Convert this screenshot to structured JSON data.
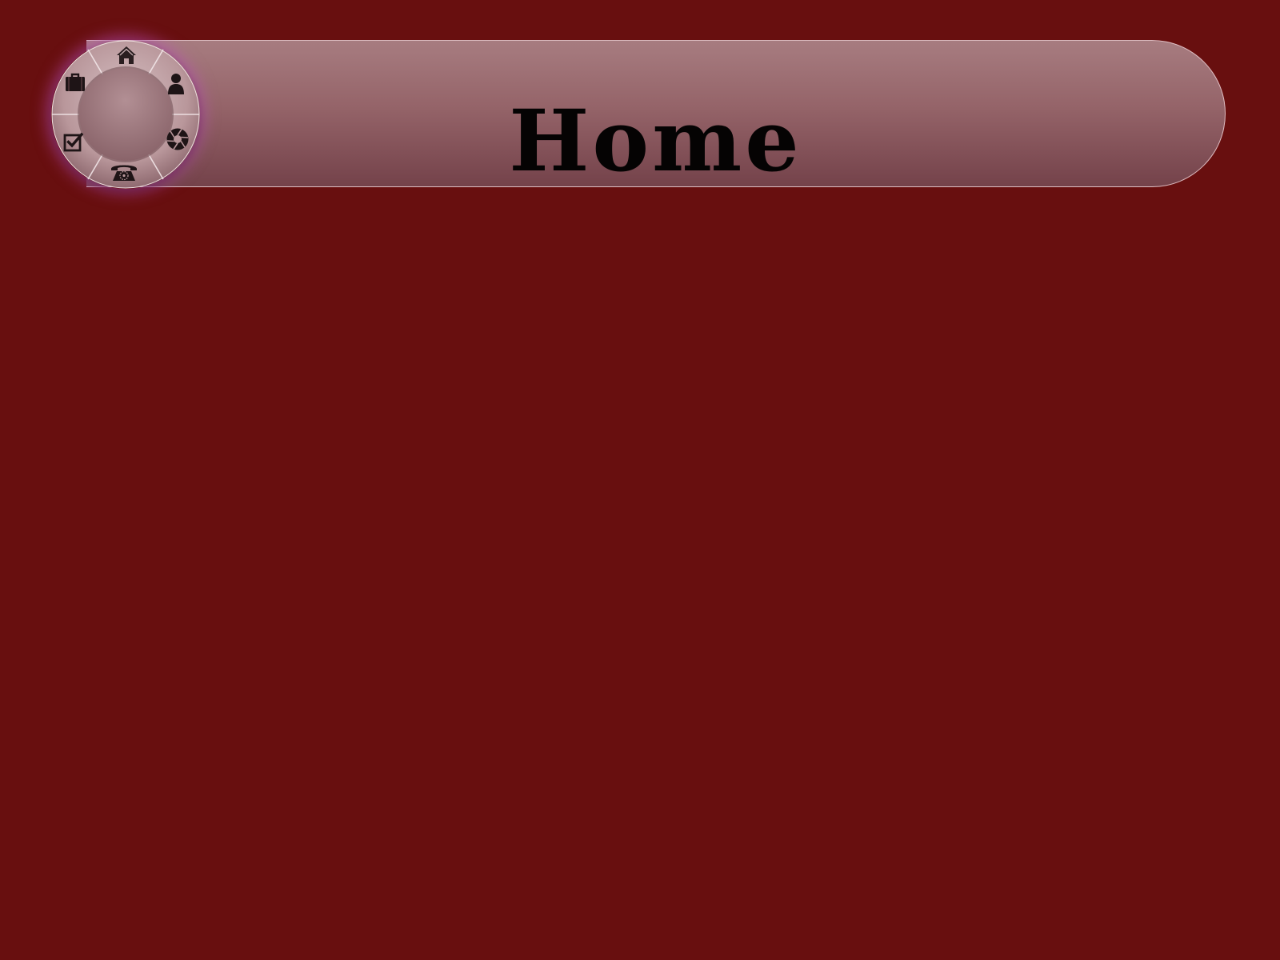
{
  "header": {
    "title": "Home"
  },
  "nav_wheel": {
    "items": [
      {
        "icon": "home-icon"
      },
      {
        "icon": "user-icon"
      },
      {
        "icon": "aperture-icon"
      },
      {
        "icon": "telephone-icon"
      },
      {
        "icon": "checkbox-icon"
      },
      {
        "icon": "briefcase-icon"
      }
    ]
  },
  "colors": {
    "background": "#680f0f",
    "bar_top": "#a77c80",
    "bar_bottom": "#74424a",
    "wheel_glow": "#be50be",
    "icon": "#2a1e20"
  }
}
